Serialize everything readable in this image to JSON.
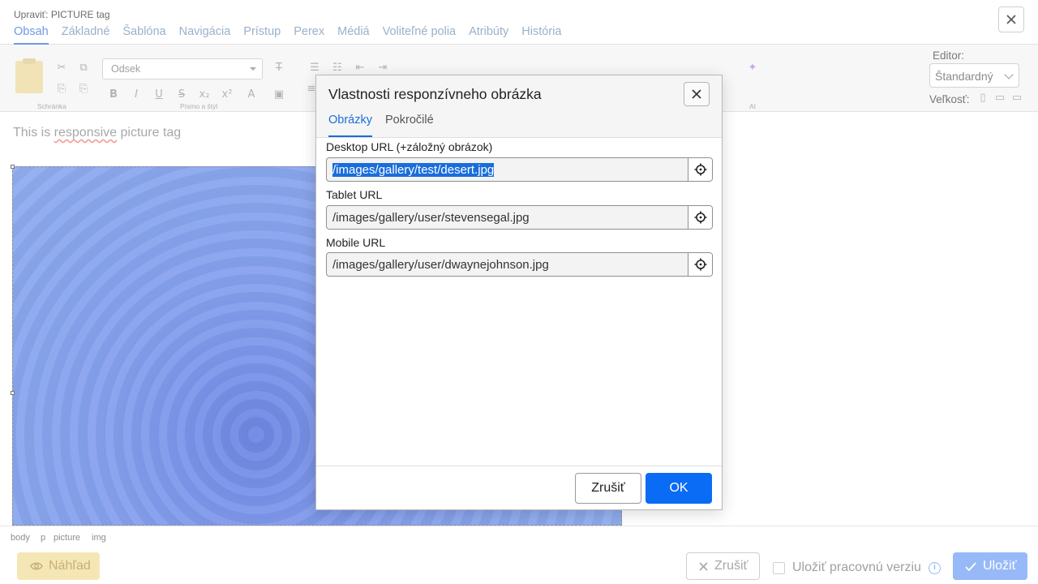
{
  "window": {
    "title": "Upraviť: PICTURE tag",
    "tabs": [
      "Obsah",
      "Základné",
      "Šablóna",
      "Navigácia",
      "Prístup",
      "Perex",
      "Médiá",
      "Voliteľné polia",
      "Atribúty",
      "História"
    ],
    "active_tab": "Obsah"
  },
  "toolbar": {
    "format_select": "Odsek",
    "groups": {
      "clipboard": "Schránka",
      "font_style": "Písmo a štýl",
      "ai": "AI"
    },
    "editor_label": "Editor:",
    "editor_value": "Štandardný",
    "size_label": "Veľkosť:"
  },
  "content": {
    "paragraph_text": "This is responsive picture tag"
  },
  "statusbar": {
    "crumbs": [
      "body",
      "p",
      "picture",
      "img"
    ]
  },
  "footer": {
    "preview_label": "Náhľad",
    "cancel_label": "Zrušiť",
    "work_version_label": "Uložiť pracovnú verziu",
    "save_label": "Uložiť"
  },
  "dialog": {
    "title": "Vlastnosti responzívneho obrázka",
    "tabs": [
      "Obrázky",
      "Pokročilé"
    ],
    "active_tab": "Obrázky",
    "fields": [
      {
        "label": "Desktop URL (+záložný obrázok)",
        "value": "/images/gallery/test/desert.jpg",
        "selected": true
      },
      {
        "label": "Tablet URL",
        "value": "/images/gallery/user/stevensegal.jpg",
        "selected": false
      },
      {
        "label": "Mobile URL",
        "value": "/images/gallery/user/dwaynejohnson.jpg",
        "selected": false
      }
    ],
    "cancel_label": "Zrušiť",
    "ok_label": "OK"
  },
  "colors": {
    "accent": "#0a6cf5",
    "selection": "#1a6ddb",
    "preview_button": "#f5e7b5"
  }
}
